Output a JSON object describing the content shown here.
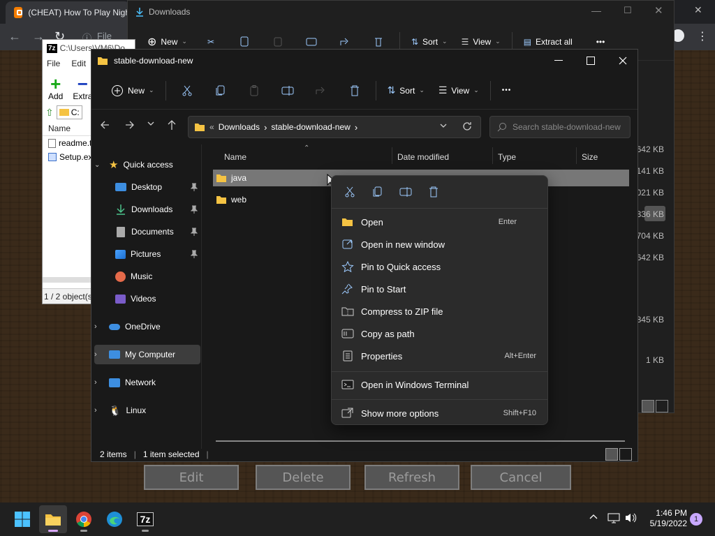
{
  "chrome": {
    "tab_title": "(CHEAT) How To Play Nigh",
    "omnibox_partial": "File"
  },
  "sevenzip": {
    "app_badge": "7z",
    "title": "C:\\Users\\VM6\\Do",
    "menu": [
      "File",
      "Edit"
    ],
    "tools": {
      "add": "Add",
      "extract": "Extra"
    },
    "address": "C:",
    "column_name": "Name",
    "files": [
      "readme.t",
      "Setup.ex"
    ],
    "status": "1 / 2 object(s"
  },
  "downloads_window": {
    "title": "Downloads",
    "new_label": "New",
    "sort_label": "Sort",
    "view_label": "View",
    "extract_label": "Extract all",
    "sizes": [
      "642 KB",
      "141 KB",
      "021 KB",
      "336 KB",
      "704 KB",
      "642 KB",
      "845 KB",
      "1 KB"
    ]
  },
  "explorer": {
    "title": "stable-download-new",
    "toolbar": {
      "new_label": "New",
      "sort_label": "Sort",
      "view_label": "View",
      "more_label": "•••"
    },
    "breadcrumb": {
      "overflow": "«",
      "items": [
        "Downloads",
        "stable-download-new"
      ]
    },
    "search_placeholder": "Search stable-download-new",
    "nav": {
      "quick_access": "Quick access",
      "desktop": "Desktop",
      "downloads": "Downloads",
      "documents": "Documents",
      "pictures": "Pictures",
      "music": "Music",
      "videos": "Videos",
      "onedrive": "OneDrive",
      "my_computer": "My Computer",
      "network": "Network",
      "linux": "Linux"
    },
    "columns": {
      "name": "Name",
      "date": "Date modified",
      "type": "Type",
      "size": "Size"
    },
    "files": [
      {
        "name": "java"
      },
      {
        "name": "web"
      }
    ],
    "status": {
      "items": "2 items",
      "selected": "1 item selected"
    }
  },
  "context_menu": {
    "items": {
      "open": {
        "label": "Open",
        "shortcut": "Enter"
      },
      "open_new_window": {
        "label": "Open in new window"
      },
      "pin_quick": {
        "label": "Pin to Quick access"
      },
      "pin_start": {
        "label": "Pin to Start"
      },
      "compress": {
        "label": "Compress to ZIP file"
      },
      "copy_path": {
        "label": "Copy as path"
      },
      "properties": {
        "label": "Properties",
        "shortcut": "Alt+Enter"
      },
      "terminal": {
        "label": "Open in Windows Terminal"
      },
      "more": {
        "label": "Show more options",
        "shortcut": "Shift+F10"
      }
    }
  },
  "dialog_buttons": {
    "edit": "Edit",
    "delete": "Delete",
    "refresh": "Refresh",
    "cancel": "Cancel"
  },
  "taskbar": {
    "time": "1:46 PM",
    "date": "5/19/2022",
    "notification_count": "1",
    "sevenzip_label": "7z"
  },
  "colors": {
    "explorer_bg": "#191919",
    "menu_bg": "#2b2b2b",
    "accent_blue": "#4cc2ff",
    "folder_yellow": "#f5c343"
  }
}
